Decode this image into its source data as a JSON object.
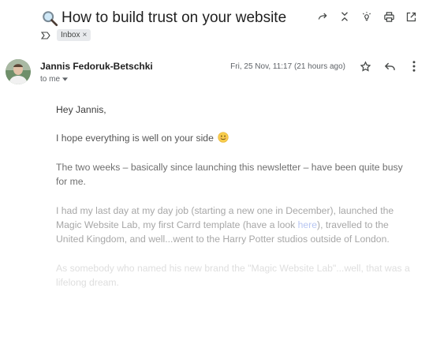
{
  "header": {
    "subject": "How to build trust on your website",
    "subject_icon": "magnifier-icon",
    "labels": [
      {
        "text": "Inbox",
        "remove": "×"
      }
    ],
    "toolbar_icons": [
      "forward-icon",
      "collapse-icon",
      "lightbulb-icon",
      "print-icon",
      "open-new-window-icon"
    ]
  },
  "message": {
    "sender": "Jannis Fedoruk-Betschki",
    "recipient": "to me",
    "date": "Fri, 25 Nov, 11:17 (21 hours ago)",
    "actions": [
      "star-icon",
      "reply-icon",
      "more-vert-icon"
    ],
    "body": {
      "greeting": "Hey Jannis,",
      "p1": "I hope everything is well on your side",
      "p1_emoji": "smiling-face-emoji",
      "p2": "The two weeks – basically since launching this newsletter – have been quite busy for me.",
      "p3_before": "I had my last day at my day job (starting a new one in December), launched the Magic Website Lab, my first Carrd template (have a look ",
      "p3_link": "here",
      "p3_after": "), travelled to the United Kingdom, and well...went to the Harry Potter studios outside of London.",
      "p4": "As somebody who named his new brand the \"Magic Website Lab\"...well, that was a lifelong dream."
    }
  },
  "colors": {
    "link": "#b7c6f2",
    "chip_bg": "#e8eaed",
    "text": "#202124"
  }
}
